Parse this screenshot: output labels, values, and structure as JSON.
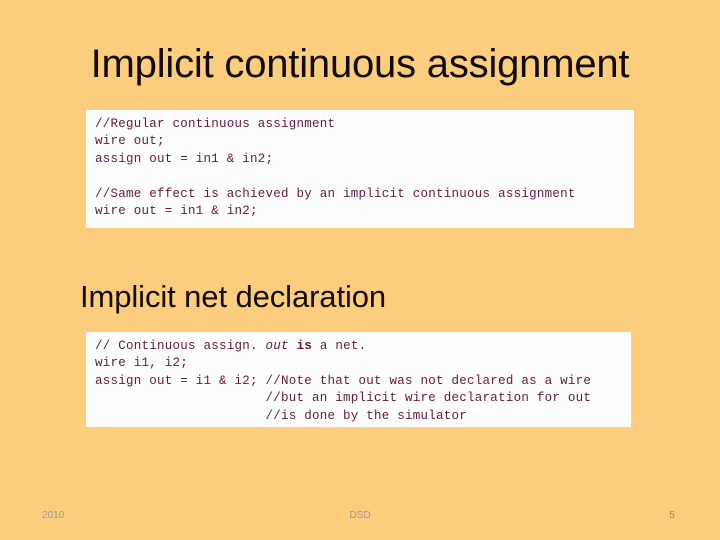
{
  "slide": {
    "title": "Implicit continuous assignment",
    "section_title": "Implicit net declaration",
    "background_color": "#fccd7c",
    "code_text_color": "#5f1a3d",
    "code_background_color": "#fdfdfd"
  },
  "code_block_1": {
    "lines": [
      "//Regular continuous assignment",
      "wire out;",
      "assign out = in1 & in2;",
      "",
      "//Same effect is achieved by an implicit continuous assignment",
      "wire out = in1 & in2;"
    ]
  },
  "code_block_2": {
    "line_1_part_a": "// Continuous assign. ",
    "line_1_emph": "out",
    "line_1_part_b": " ",
    "line_1_bold": "is",
    "line_1_part_c": " a net.",
    "line_2": "wire i1, i2;",
    "line_3": "assign out = i1 & i2; //Note that out was not declared as a wire",
    "line_4": "                      //but an implicit wire declaration for out",
    "line_5": "                      //is done by the simulator"
  },
  "footer": {
    "date": "2010",
    "subject": "DSD",
    "page_number": "5"
  }
}
